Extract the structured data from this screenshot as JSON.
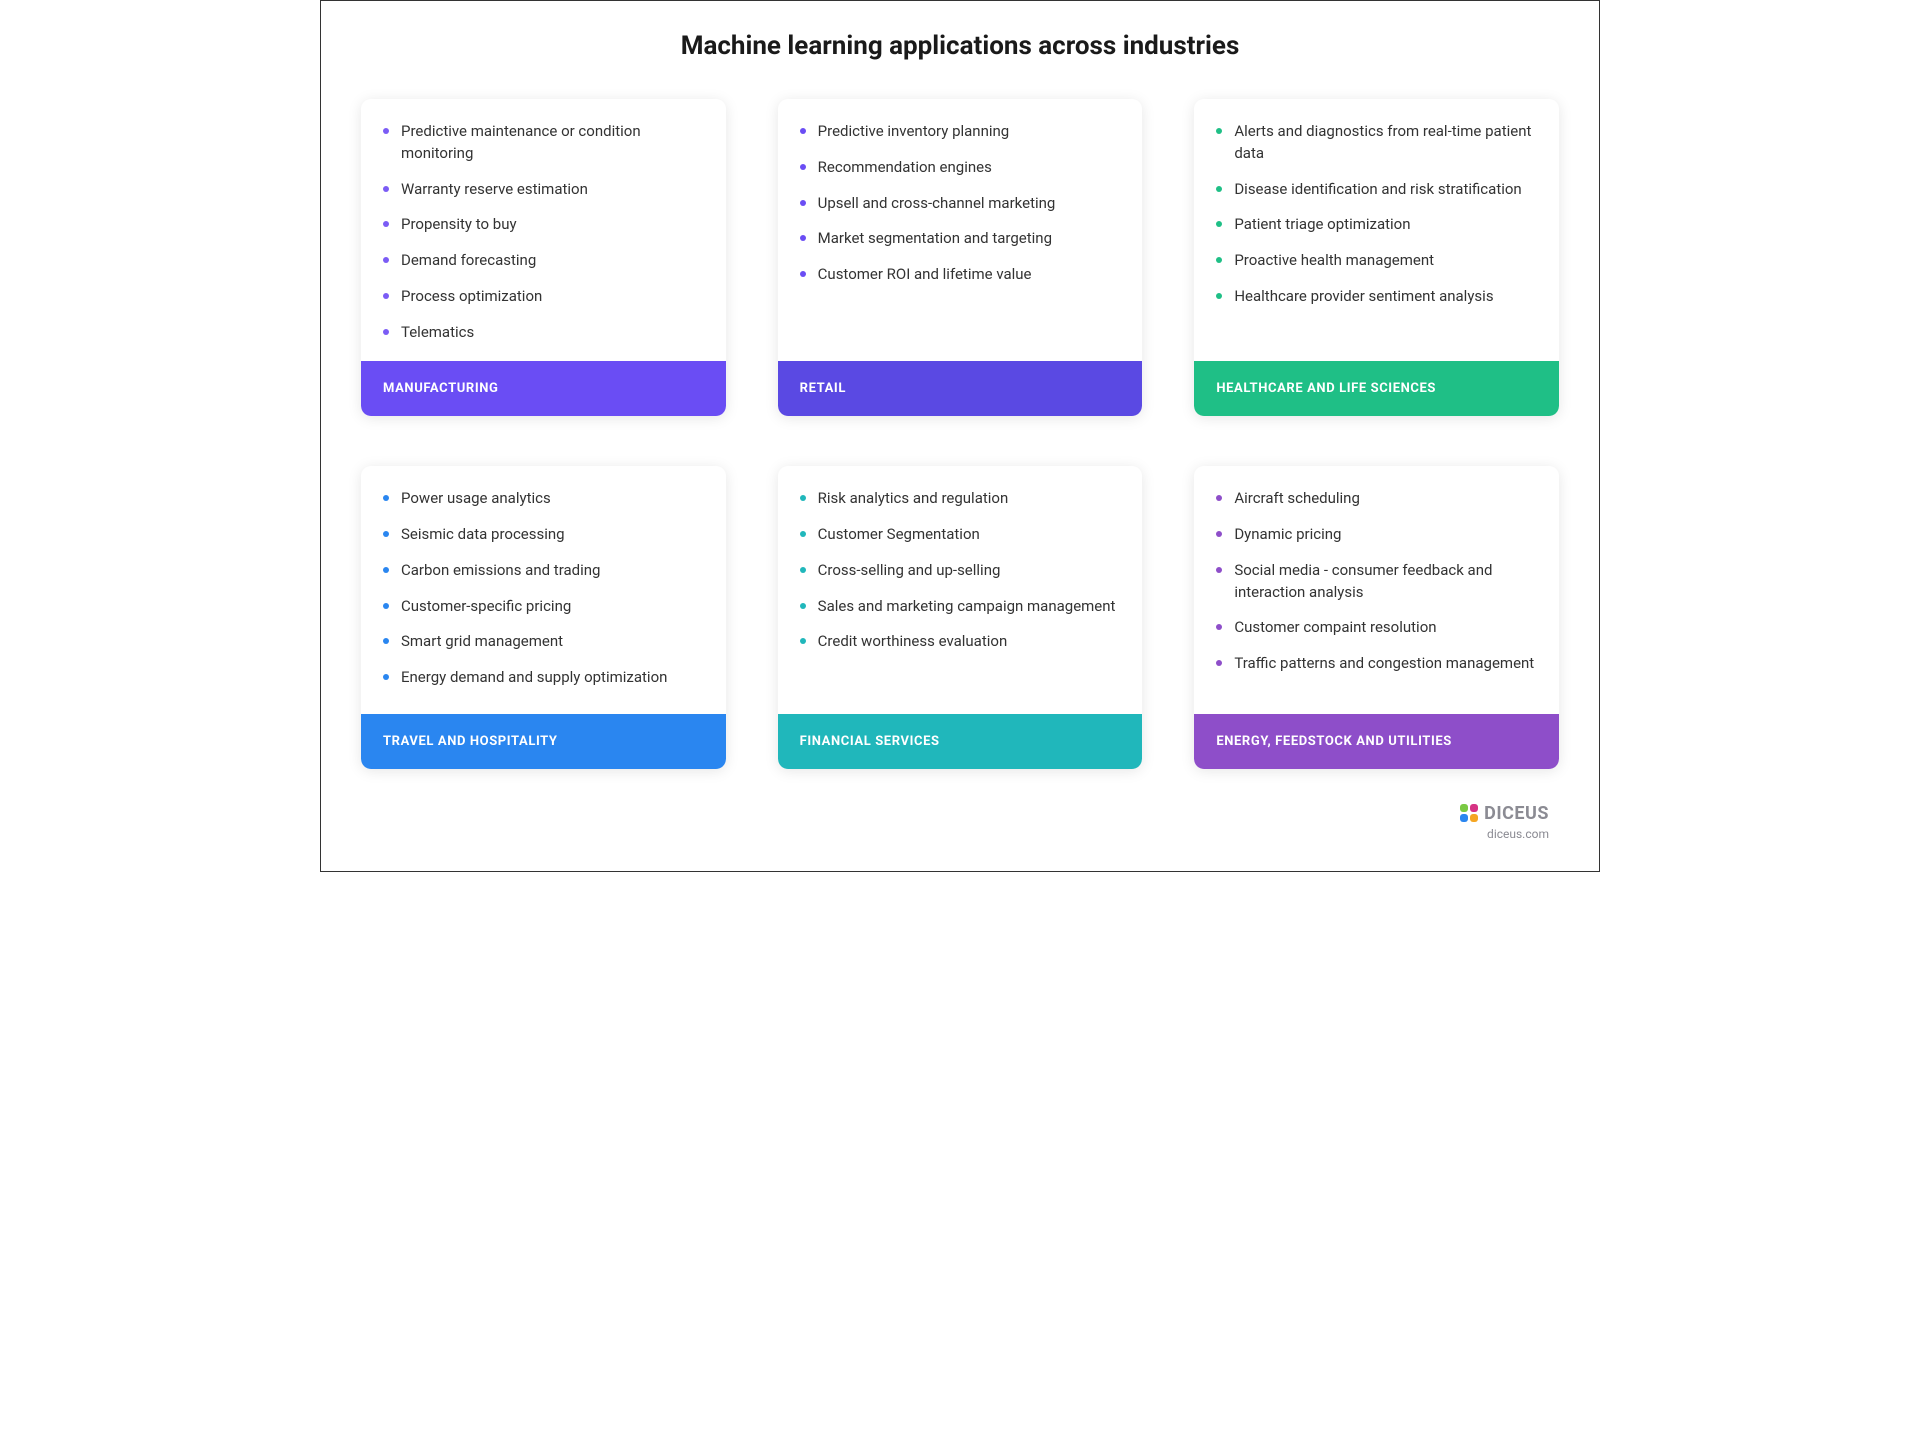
{
  "title": "Machine learning applications across industries",
  "cards": [
    {
      "label": "MANUFACTURING",
      "footer_color": "#6a4df4",
      "bullet_color": "#7b5cf5",
      "items": [
        "Predictive maintenance or condition monitoring",
        "Warranty reserve estimation",
        "Propensity to buy",
        "Demand forecasting",
        "Process optimization",
        "Telematics"
      ]
    },
    {
      "label": "RETAIL",
      "footer_color": "#5a49e3",
      "bullet_color": "#6a4df4",
      "items": [
        "Predictive inventory planning",
        "Recommendation engines",
        "Upsell and cross-channel marketing",
        "Market segmentation and targeting",
        "Customer ROI and lifetime value"
      ]
    },
    {
      "label": "HEALTHCARE AND LIFE SCIENCES",
      "footer_color": "#1fbf86",
      "bullet_color": "#1fbf86",
      "items": [
        "Alerts and diagnostics from real-time patient data",
        "Disease identification and risk stratification",
        "Patient triage optimization",
        "Proactive health management",
        "Healthcare provider sentiment analysis"
      ]
    },
    {
      "label": "TRAVEL AND HOSPITALITY",
      "footer_color": "#2a86f0",
      "bullet_color": "#2a86f0",
      "items": [
        "Power usage analytics",
        "Seismic data processing",
        "Carbon emissions and trading",
        "Customer-specific pricing",
        "Smart grid management",
        "Energy demand and supply optimization"
      ]
    },
    {
      "label": "FINANCIAL SERVICES",
      "footer_color": "#20b7bb",
      "bullet_color": "#20b7bb",
      "items": [
        "Risk analytics and regulation",
        "Customer Segmentation",
        "Cross-selling and up-selling",
        "Sales and marketing campaign management",
        "Credit worthiness evaluation"
      ]
    },
    {
      "label": "ENERGY, FEEDSTOCK AND UTILITIES",
      "footer_color": "#8e4ec9",
      "bullet_color": "#8e4ec9",
      "items": [
        "Aircraft scheduling",
        "Dynamic pricing",
        "Social media - consumer feedback and interaction analysis",
        "Customer compaint resolution",
        "Traffic patterns and congestion management"
      ]
    }
  ],
  "attribution": {
    "brand": "DICEUS",
    "url": "diceus.com",
    "logo_colors": [
      "#7ac943",
      "#d63384",
      "#2a86f0",
      "#f5a623"
    ]
  }
}
